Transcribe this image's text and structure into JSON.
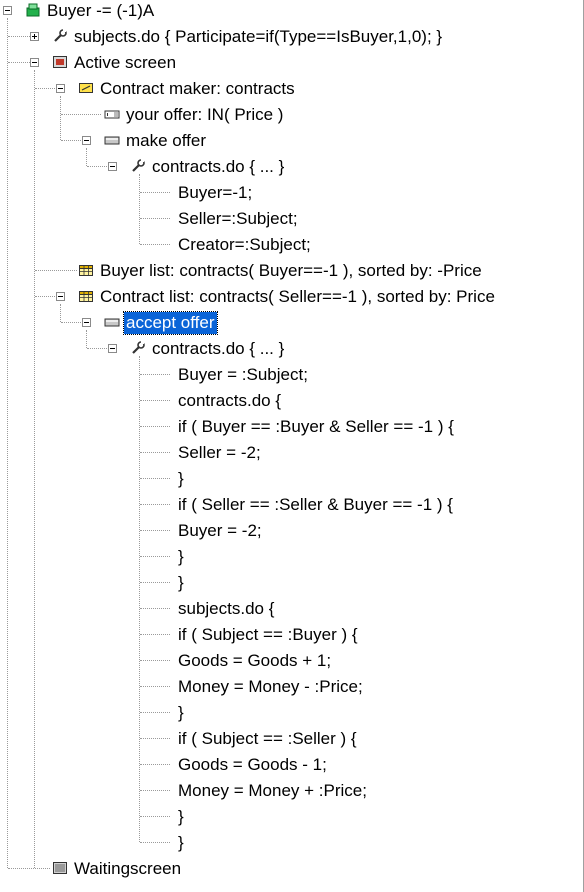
{
  "tree": {
    "root_label": "Buyer -= (-1)A",
    "subjects_do_label": "subjects.do { Participate=if(Type==IsBuyer,1,0); }",
    "active_screen_label": "Active screen",
    "contract_maker_label": "Contract maker: contracts",
    "your_offer_label": "your offer: IN( Price )",
    "make_offer_label": "make offer",
    "contracts_do_1_label": "contracts.do {  ... }",
    "make_offer_code": [
      "Buyer=-1;",
      "Seller=:Subject;",
      "Creator=:Subject;"
    ],
    "buyer_list_label": "Buyer list: contracts( Buyer==-1 ), sorted by: -Price",
    "contract_list_label": "Contract list: contracts( Seller==-1 ), sorted by: Price",
    "accept_offer_label": "accept offer",
    "contracts_do_2_label": "contracts.do {  ... }",
    "accept_offer_code": [
      "Buyer = :Subject;",
      "contracts.do {",
      "if ( Buyer == :Buyer & Seller == -1 ) {",
      "Seller = -2;",
      "}",
      "if ( Seller == :Seller & Buyer == -1 ) {",
      "Buyer = -2;",
      "}",
      "}",
      "subjects.do {",
      "if ( Subject == :Buyer ) {",
      "Goods = Goods + 1;",
      "Money = Money - :Price;",
      "}",
      "if ( Subject == :Seller ) {",
      "Goods = Goods - 1;",
      "Money = Money + :Price;",
      "}",
      "}"
    ],
    "waiting_screen_label": "Waitingscreen"
  },
  "icons": {
    "root": "stage-icon",
    "subjects_do": "wrench-icon",
    "active_screen": "screen-icon",
    "contract_maker": "contract-maker-icon",
    "your_offer": "input-box-icon",
    "make_offer": "button-icon",
    "contracts_do": "wrench-icon",
    "buyer_list": "table-icon",
    "contract_list": "table-icon",
    "accept_offer": "button-icon",
    "waiting_screen": "screen-icon"
  },
  "colors": {
    "selection": "#0a64d8",
    "root_icon": "#22b14c",
    "screen_icon": "#c0392b",
    "table_icon": "#e0b000"
  }
}
